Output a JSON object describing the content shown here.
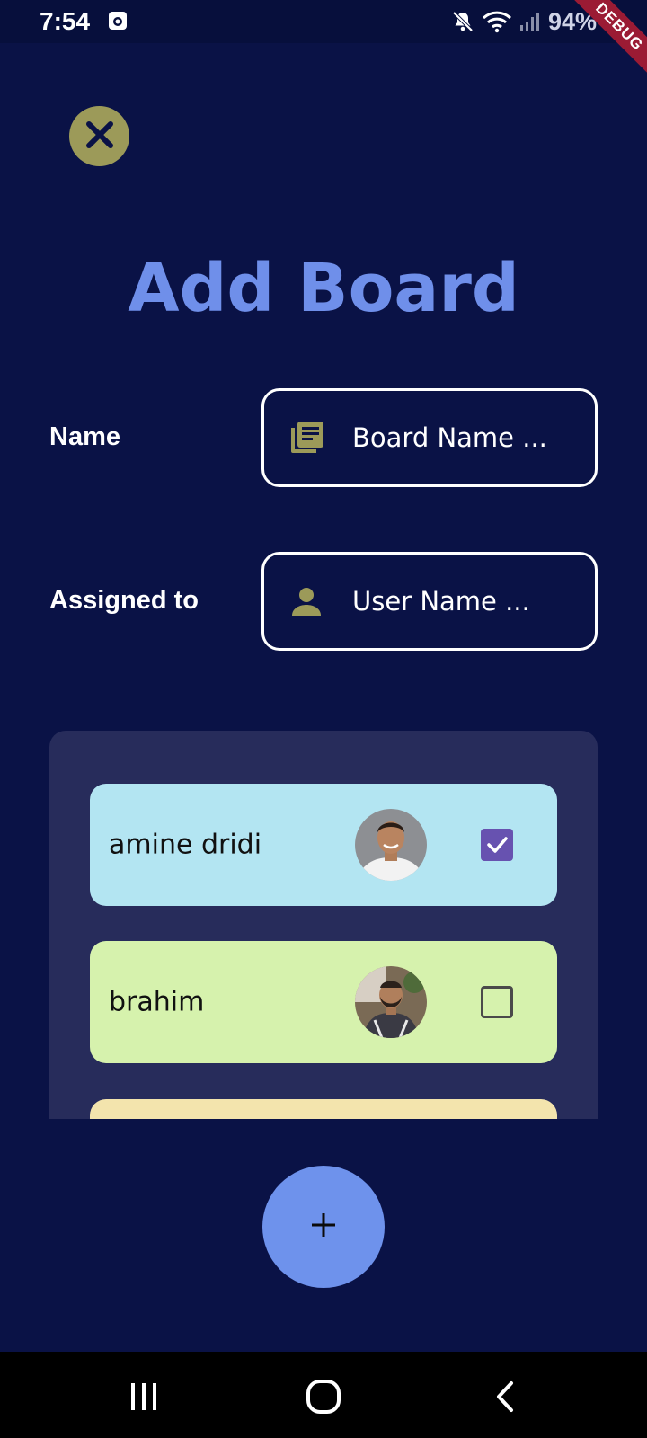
{
  "status_bar": {
    "time": "7:54",
    "battery": "94%"
  },
  "debug_banner": "DEBUG",
  "page": {
    "title": "Add Board"
  },
  "form": {
    "name_label": "Name",
    "name_placeholder": "Board Name ...",
    "assigned_label": "Assigned to",
    "user_placeholder": "User Name ..."
  },
  "users": [
    {
      "name": "amine dridi",
      "checked": true,
      "card_color": "#b3e5f2"
    },
    {
      "name": "brahim",
      "checked": false,
      "card_color": "#d6f2ad"
    }
  ],
  "colors": {
    "background": "#0a1246",
    "accent": "#6e92ec",
    "close_button": "#9c9a59",
    "icon_olive": "#9c9a59",
    "checkbox_checked": "#6752b0",
    "panel": "#272c5b"
  },
  "icons": {
    "close": "close-icon",
    "board": "library-books-icon",
    "user": "person-icon",
    "add": "plus-icon"
  }
}
